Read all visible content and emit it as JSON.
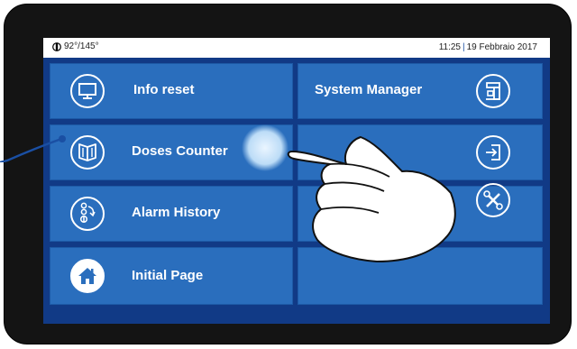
{
  "status": {
    "temperature": "92°/145°",
    "time": "11:25",
    "separator": "|",
    "date": "19 Febbraio 2017"
  },
  "menu": {
    "info_reset": "Info reset",
    "system_manager": "System Manager",
    "doses_counter": "Doses Counter",
    "alarm_history": "Alarm History",
    "initial_page": "Initial Page"
  },
  "icons": {
    "info_reset": "monitor-icon",
    "system_manager": "coffee-machine-icon",
    "doses_counter": "book-icon",
    "exit": "exit-door-icon",
    "alarm_history": "alarm-history-icon",
    "tools": "tools-icon",
    "initial_page": "home-icon"
  },
  "colors": {
    "tile": "#2a6ebd",
    "background": "#113a86",
    "callout": "#1a4fa3",
    "touch_glow": "#bcdcf7"
  }
}
